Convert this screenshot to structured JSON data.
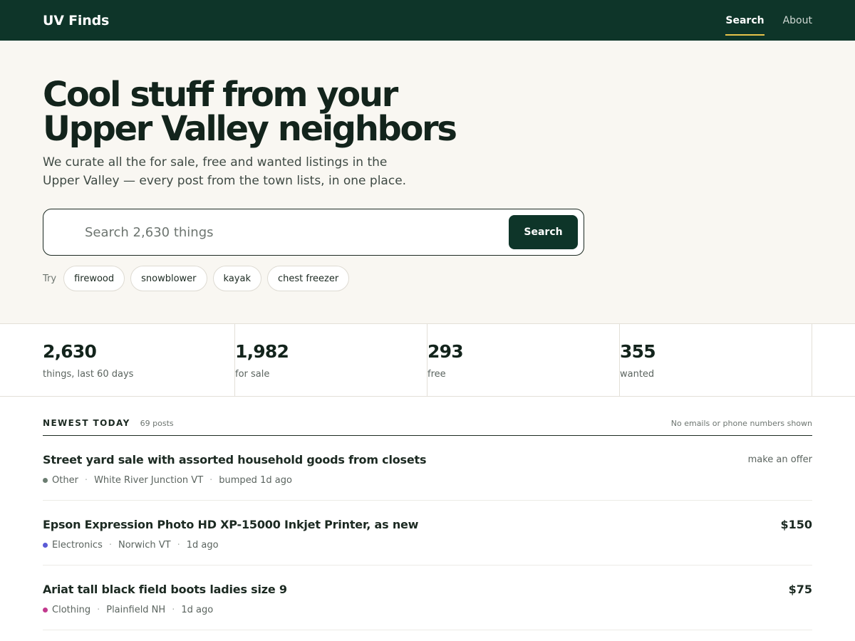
{
  "header": {
    "brand": "UV Finds",
    "nav": [
      {
        "label": "Search",
        "active": true
      },
      {
        "label": "About",
        "active": false
      }
    ]
  },
  "hero": {
    "title": "Cool stuff from your Upper Valley neighbors",
    "subtitle": "We curate all the for sale, free and wanted listings in the Upper Valley — every post from the town lists, in one place.",
    "search": {
      "placeholder": "Search 2,630 things",
      "value": "",
      "button_label": "Search"
    },
    "try": {
      "label": "Try",
      "chips": [
        "firewood",
        "snowblower",
        "kayak",
        "chest freezer"
      ]
    }
  },
  "stats": [
    {
      "value": "2,630",
      "label": "things, last 60 days"
    },
    {
      "value": "1,982",
      "label": "for sale"
    },
    {
      "value": "293",
      "label": "free"
    },
    {
      "value": "355",
      "label": "wanted"
    }
  ],
  "listings": {
    "heading": "NEWEST TODAY",
    "count": "69 posts",
    "note": "No emails or phone numbers shown",
    "items": [
      {
        "title": "Street yard sale with assorted household goods from closets",
        "category": "Other",
        "category_color": "#6b7d71",
        "location": "White River Junction VT",
        "time": "bumped 1d ago",
        "price": "make an offer"
      },
      {
        "title": "Epson Expression Photo HD XP-15000 Inkjet Printer, as new",
        "category": "Electronics",
        "category_color": "#5b5bd6",
        "location": "Norwich VT",
        "time": "1d ago",
        "price": "$150"
      },
      {
        "title": "Ariat tall black field boots ladies size 9",
        "category": "Clothing",
        "category_color": "#c23a8e",
        "location": "Plainfield NH",
        "time": "1d ago",
        "price": "$75"
      }
    ]
  }
}
